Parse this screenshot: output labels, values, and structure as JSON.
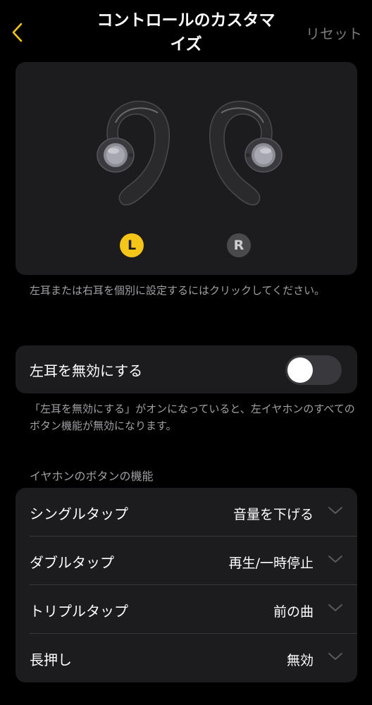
{
  "header": {
    "title_line1": "コントロールのカスタマ",
    "title_line2": "イズ",
    "reset_label": "リセット",
    "accent_color": "#f5c518"
  },
  "earbuds": {
    "left_badge": "L",
    "right_badge": "R",
    "selected": "L",
    "hint": "左耳または右耳を個別に設定するにはクリックしてください。"
  },
  "disable": {
    "label": "左耳を無効にする",
    "enabled": false,
    "hint": "「左耳を無効にする」がオンになっていると、左イヤホンのすべてのボタン機能が無効になります。"
  },
  "functions": {
    "section_title": "イヤホンのボタンの機能",
    "rows": [
      {
        "name": "シングルタップ",
        "value": "音量を下げる"
      },
      {
        "name": "ダブルタップ",
        "value": "再生/一時停止"
      },
      {
        "name": "トリプルタップ",
        "value": "前の曲"
      },
      {
        "name": "長押し",
        "value": "無効"
      }
    ]
  }
}
